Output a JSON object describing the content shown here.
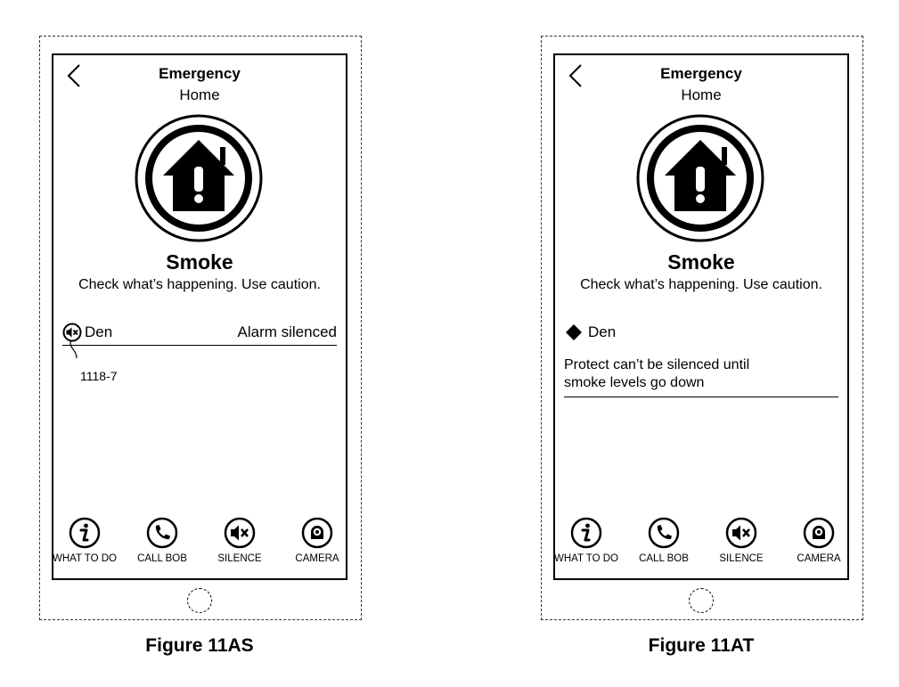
{
  "figures": [
    {
      "caption": "Figure 11AS",
      "header": {
        "title": "Emergency",
        "subtitle": "Home"
      },
      "status": {
        "title": "Smoke",
        "description": "Check what’s happening. Use caution."
      },
      "device_row": {
        "icon": "speaker-muted-icon",
        "name": "Den",
        "state": "Alarm silenced"
      },
      "reference_label": "1118-7",
      "actions": [
        {
          "icon": "info-icon",
          "label": "WHAT TO DO"
        },
        {
          "icon": "phone-icon",
          "label": "CALL BOB"
        },
        {
          "icon": "speaker-muted-icon",
          "label": "SILENCE"
        },
        {
          "icon": "camera-icon",
          "label": "CAMERA"
        }
      ]
    },
    {
      "caption": "Figure 11AT",
      "header": {
        "title": "Emergency",
        "subtitle": "Home"
      },
      "status": {
        "title": "Smoke",
        "description": "Check what’s happening. Use caution."
      },
      "device_row": {
        "icon": "diamond-icon",
        "name": "Den"
      },
      "message": [
        "Protect can’t be silenced until",
        "smoke levels go down"
      ],
      "actions": [
        {
          "icon": "info-icon",
          "label": "WHAT TO DO"
        },
        {
          "icon": "phone-icon",
          "label": "CALL BOB"
        },
        {
          "icon": "speaker-muted-icon",
          "label": "SILENCE"
        },
        {
          "icon": "camera-icon",
          "label": "CAMERA"
        }
      ]
    }
  ]
}
